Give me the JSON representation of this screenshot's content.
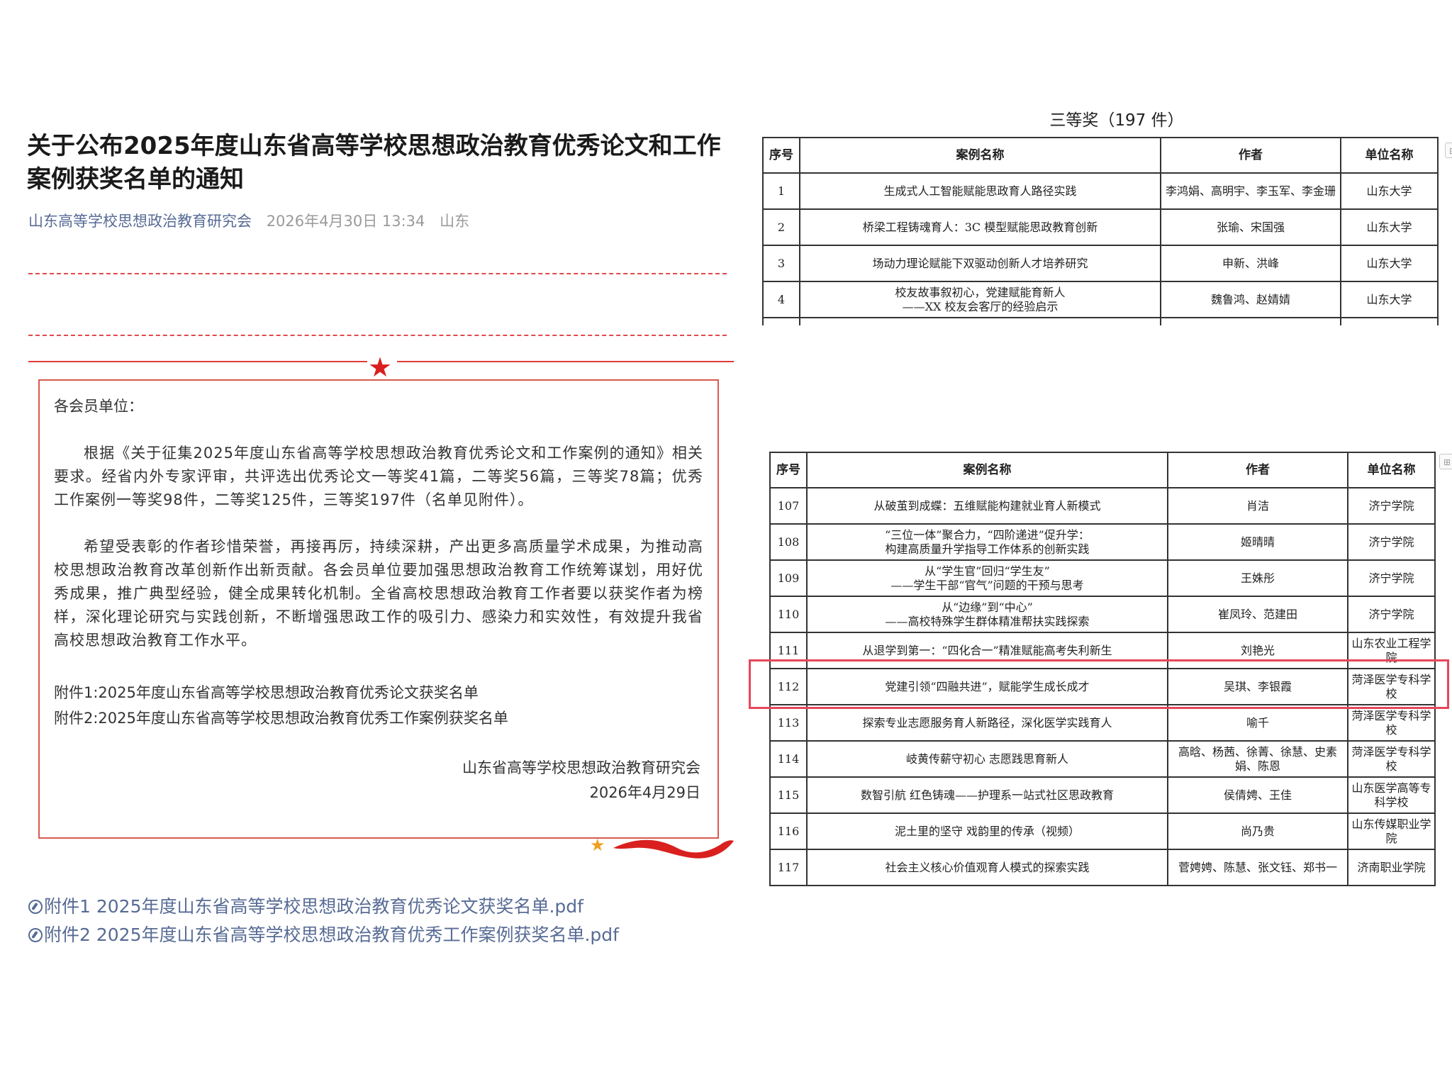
{
  "article": {
    "title": "关于公布2025年度山东省高等学校思想政治教育优秀论文和工作案例获奖名单的通知",
    "account": "山东高等学校思想政治教育研究会",
    "date": "2026年4月30日 13:34",
    "location": "山东"
  },
  "notice": {
    "salutation": "各会员单位：",
    "para1": "根据《关于征集2025年度山东省高等学校思想政治教育优秀论文和工作案例的通知》相关要求。经省内外专家评审，共评选出优秀论文一等奖41篇，二等奖56篇，三等奖78篇；优秀工作案例一等奖98件，二等奖125件，三等奖197件（名单见附件）。",
    "para2": "希望受表彰的作者珍惜荣誉，再接再厉，持续深耕，产出更多高质量学术成果，为推动高校思想政治教育改革创新作出新贡献。各会员单位要加强思想政治教育工作统筹谋划，用好优秀成果，推广典型经验，健全成果转化机制。全省高校思想政治教育工作者要以获奖作者为榜样，深化理论研究与实践创新，不断增强思政工作的吸引力、感染力和实效性，有效提升我省高校思想政治教育工作水平。",
    "attachment1": "附件1:2025年度山东省高等学校思想政治教育优秀论文获奖名单",
    "attachment2": "附件2:2025年度山东省高等学校思想政治教育优秀工作案例获奖名单",
    "signature_org": "山东省高等学校思想政治教育研究会",
    "signature_date": "2026年4月29日"
  },
  "links": {
    "file1": "附件1 2025年度山东省高等学校思想政治教育优秀论文获奖名单.pdf",
    "file2": "附件2 2025年度山东省高等学校思想政治教育优秀工作案例获奖名单.pdf"
  },
  "award_section": {
    "title": "三等奖（197 件）"
  },
  "table_headers": {
    "no": "序号",
    "name": "案例名称",
    "author": "作者",
    "unit": "单位名称"
  },
  "table1": [
    {
      "no": "1",
      "name": "生成式人工智能赋能思政育人路径实践",
      "author": "李鸿娟、高明宇、李玉军、李金珊",
      "unit": "山东大学"
    },
    {
      "no": "2",
      "name": "桥梁工程铸魂育人：3C 模型赋能思政教育创新",
      "author": "张瑜、宋国强",
      "unit": "山东大学"
    },
    {
      "no": "3",
      "name": "场动力理论赋能下双驱动创新人才培养研究",
      "author": "申新、洪峰",
      "unit": "山东大学"
    },
    {
      "no": "4",
      "name": "校友故事叙初心，党建赋能育新人\n——XX 校友会客厅的经验启示",
      "author": "魏鲁鸿、赵婧婧",
      "unit": "山东大学"
    }
  ],
  "table2": [
    {
      "no": "107",
      "name": "从破茧到成蝶：五维赋能构建就业育人新模式",
      "author": "肖洁",
      "unit": "济宁学院"
    },
    {
      "no": "108",
      "name": "“三位一体”聚合力，“四阶递进”促升学：\n构建高质量升学指导工作体系的创新实践",
      "author": "姬晴晴",
      "unit": "济宁学院"
    },
    {
      "no": "109",
      "name": "从“学生官”回归“学生友”\n——学生干部“官气”问题的干预与思考",
      "author": "王姝彤",
      "unit": "济宁学院"
    },
    {
      "no": "110",
      "name": "从“边缘”到“中心”\n——高校特殊学生群体精准帮扶实践探索",
      "author": "崔凤玲、范建田",
      "unit": "济宁学院"
    },
    {
      "no": "111",
      "name": "从退学到第一：“四化合一”精准赋能高考失利新生",
      "author": "刘艳光",
      "unit": "山东农业工程学院"
    },
    {
      "no": "112",
      "name": "党建引领“四融共进”，赋能学生成长成才",
      "author": "吴琪、李银霞",
      "unit": "菏泽医学专科学校"
    },
    {
      "no": "113",
      "name": "探索专业志愿服务育人新路径，深化医学实践育人",
      "author": "喻千",
      "unit": "菏泽医学专科学校"
    },
    {
      "no": "114",
      "name": "岐黄传薪守初心 志愿践思育新人",
      "author": "高晗、杨茜、徐菁、徐慧、史素娟、陈恩",
      "unit": "菏泽医学专科学校"
    },
    {
      "no": "115",
      "name": "数智引航 红色铸魂——护理系一站式社区思政教育",
      "author": "侯倩娉、王佳",
      "unit": "山东医学高等专科学校"
    },
    {
      "no": "116",
      "name": "泥土里的坚守 戏韵里的传承（视频）",
      "author": "尚乃贵",
      "unit": "山东传媒职业学院"
    },
    {
      "no": "117",
      "name": "社会主义核心价值观育人模式的探索实践",
      "author": "菅娉娉、陈慧、张文钰、郑书一",
      "unit": "济南职业学院"
    }
  ]
}
